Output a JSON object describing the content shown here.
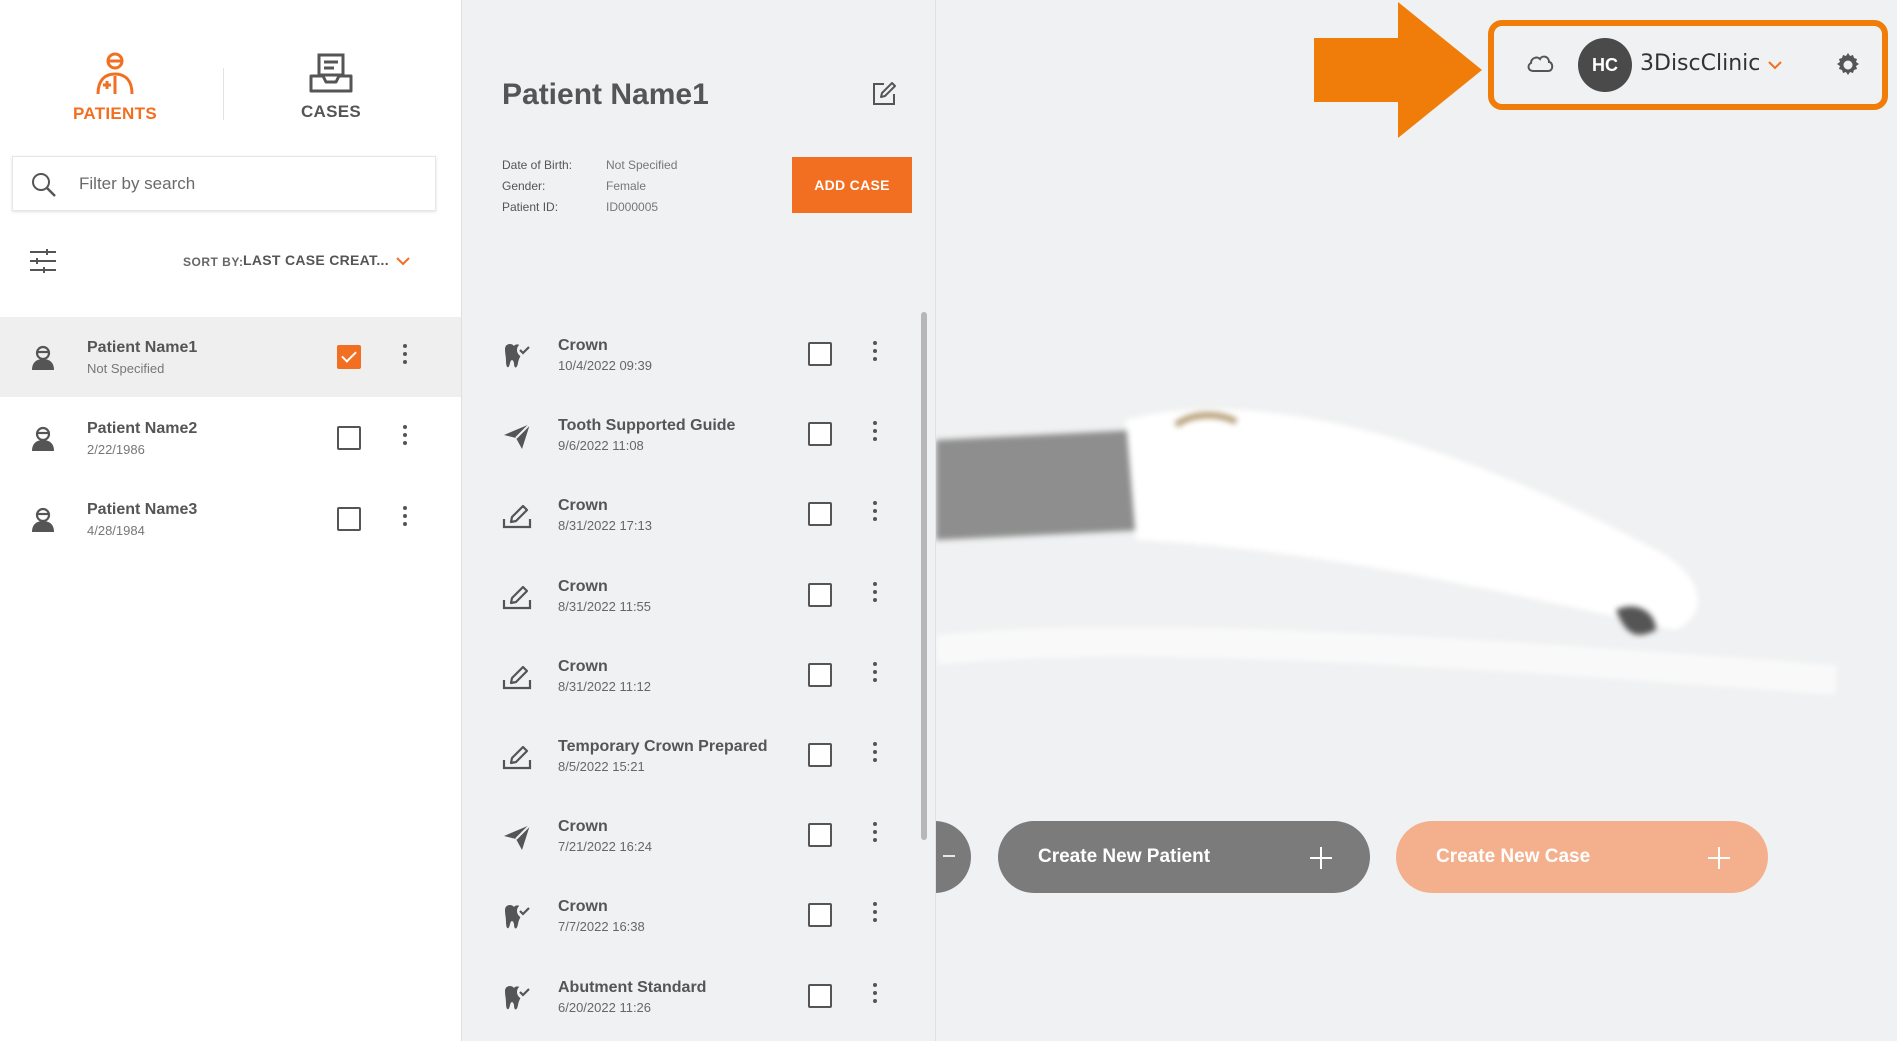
{
  "nav": {
    "tabs": [
      {
        "label": "PATIENTS",
        "icon": "patient-icon",
        "active": true
      },
      {
        "label": "CASES",
        "icon": "inbox-icon",
        "active": false
      }
    ]
  },
  "search": {
    "placeholder": "Filter by search",
    "value": ""
  },
  "sort": {
    "label": "SORT BY:",
    "value": "LAST CASE CREAT..."
  },
  "patients": [
    {
      "name": "Patient Name1",
      "sub": "Not Specified",
      "checked": true
    },
    {
      "name": "Patient Name2",
      "sub": "2/22/1986",
      "checked": false
    },
    {
      "name": "Patient Name3",
      "sub": "4/28/1984",
      "checked": false
    }
  ],
  "detail": {
    "title": "Patient Name1",
    "info": [
      {
        "key": "Date of Birth:",
        "value": "Not Specified"
      },
      {
        "key": "Gender:",
        "value": "Female"
      },
      {
        "key": "Patient ID:",
        "value": "ID000005"
      }
    ],
    "add_case_label": "ADD CASE"
  },
  "cases": [
    {
      "name": "Crown",
      "date": "10/4/2022 09:39",
      "icon": "tooth-check-icon"
    },
    {
      "name": "Tooth Supported Guide",
      "date": "9/6/2022 11:08",
      "icon": "paper-plane-icon"
    },
    {
      "name": "Crown",
      "date": "8/31/2022 17:13",
      "icon": "pen-tray-icon"
    },
    {
      "name": "Crown",
      "date": "8/31/2022 11:55",
      "icon": "pen-tray-icon"
    },
    {
      "name": "Crown",
      "date": "8/31/2022 11:12",
      "icon": "pen-tray-icon"
    },
    {
      "name": "Temporary Crown Prepared",
      "date": "8/5/2022 15:21",
      "icon": "pen-tray-icon"
    },
    {
      "name": "Crown",
      "date": "7/21/2022 16:24",
      "icon": "paper-plane-icon"
    },
    {
      "name": "Crown",
      "date": "7/7/2022 16:38",
      "icon": "tooth-check-icon"
    },
    {
      "name": "Abutment Standard",
      "date": "6/20/2022 11:26",
      "icon": "tooth-check-icon"
    }
  ],
  "actions": {
    "create_patient": "Create New Patient",
    "create_case": "Create New Case"
  },
  "user": {
    "initials": "HC",
    "clinic": "3DiscClinic"
  },
  "colors": {
    "accent": "#f26f21",
    "highlight": "#f07c0a",
    "create_patient_bg": "#7b7b7b",
    "create_case_bg": "#f4b08d"
  }
}
